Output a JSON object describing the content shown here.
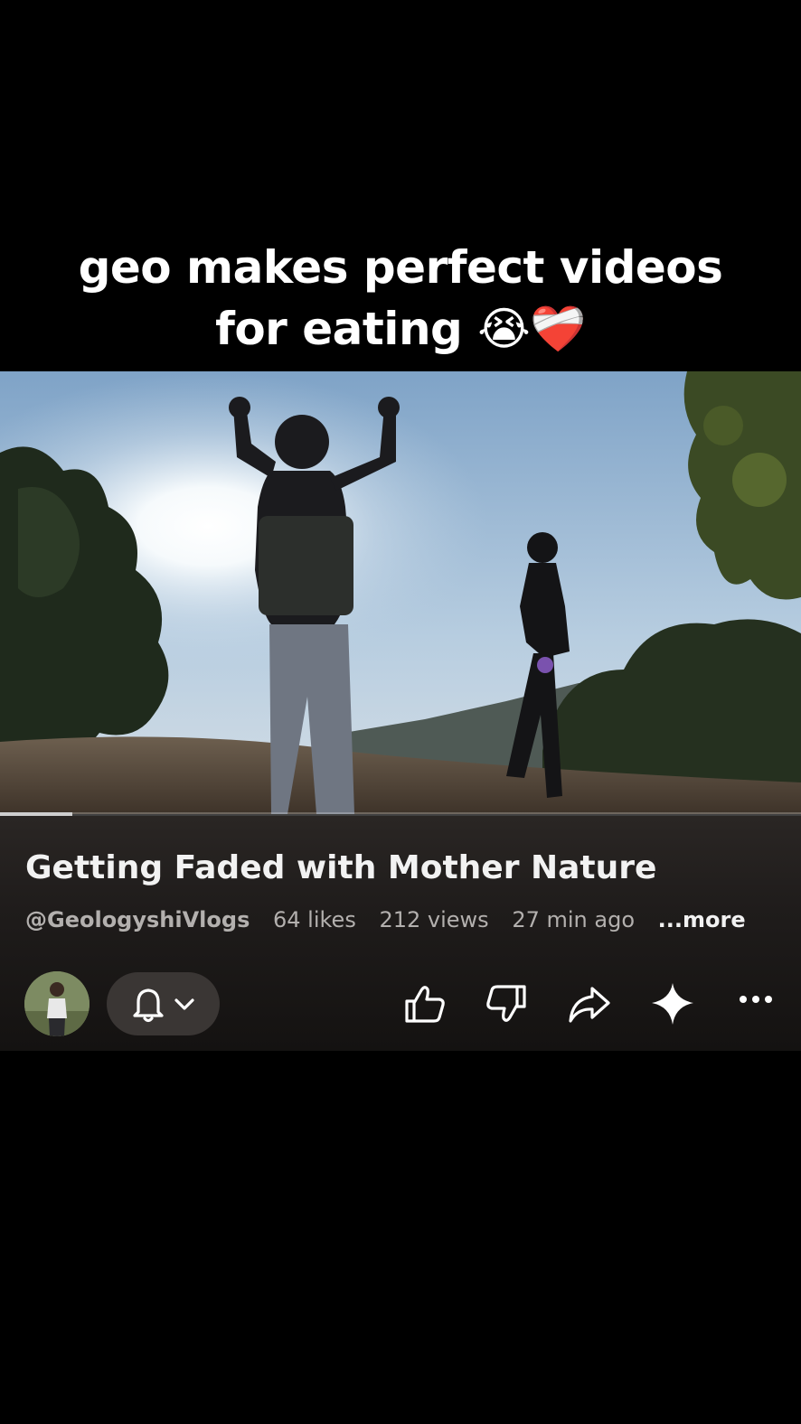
{
  "caption": {
    "line1": "geo makes perfect videos",
    "line2": "for eating 😭❤️‍🩹"
  },
  "video": {
    "progress": 0.09
  },
  "details": {
    "title": "Getting Faded with Mother Nature",
    "channel": "@GeologyshiVlogs",
    "likes": "64 likes",
    "views": "212 views",
    "time_ago": "27 min ago",
    "more_label": "...more"
  },
  "actions": {
    "icons": [
      "avatar",
      "bell-icon",
      "chevron-down-icon",
      "thumbs-up-icon",
      "thumbs-down-icon",
      "share-icon",
      "sparkle-icon",
      "more-icon"
    ]
  },
  "colors": {
    "background": "#000000",
    "panel": "#1f1c1b",
    "pill": "#3a3634",
    "meta_text": "#b3b0ae"
  }
}
